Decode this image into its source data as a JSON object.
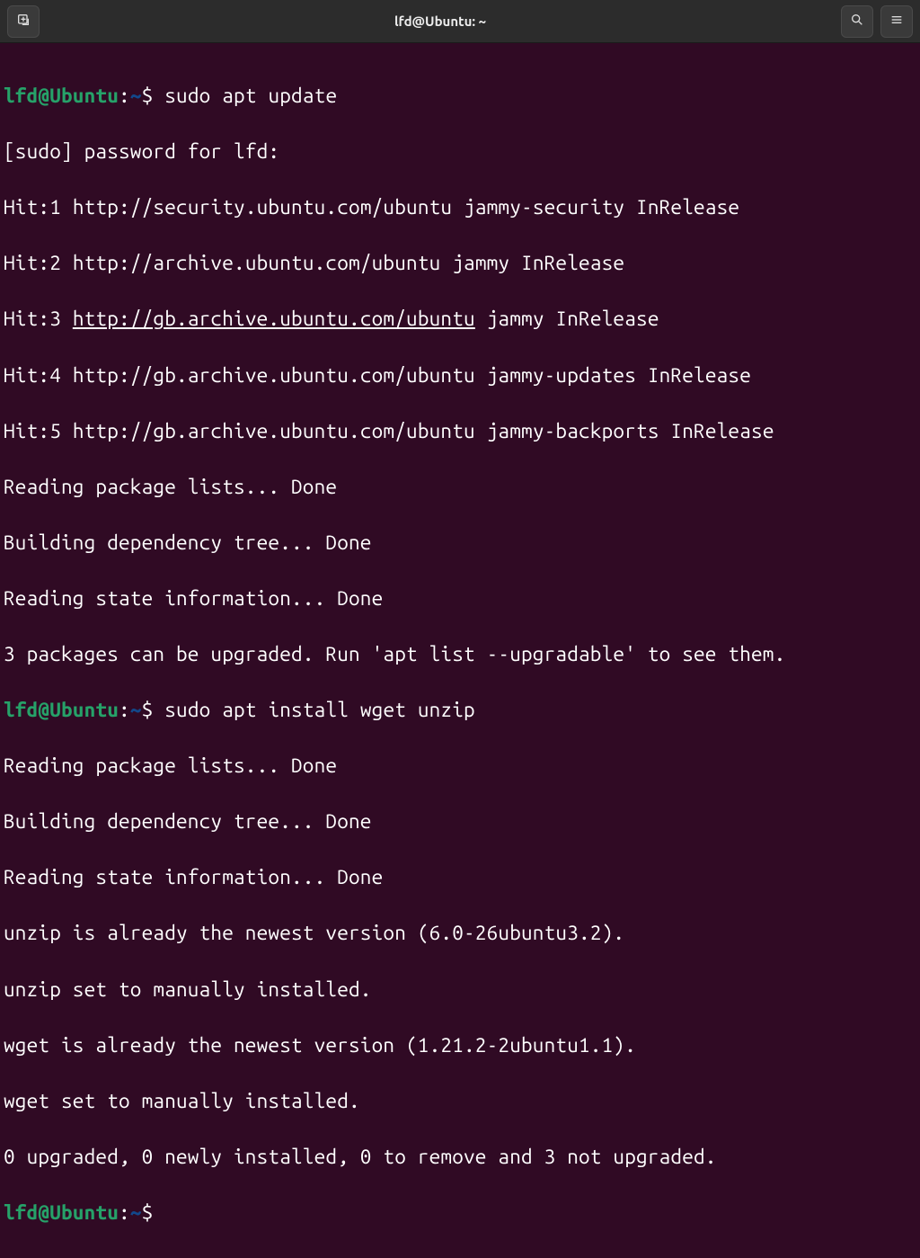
{
  "window": {
    "title": "lfd@Ubuntu: ~"
  },
  "prompt": {
    "user_host": "lfd@Ubuntu",
    "sep1": ":",
    "path": "~",
    "sep2": "$ "
  },
  "session": {
    "cmd1": "sudo apt update",
    "line_sudo_pw": "[sudo] password for lfd:",
    "hit1_a": "Hit:1 ",
    "hit1_url": "http://security.ubuntu.com/ubuntu",
    "hit1_b": " jammy-security InRelease",
    "hit2_a": "Hit:2 ",
    "hit2_url": "http://archive.ubuntu.com/ubuntu",
    "hit2_b": " jammy InRelease",
    "hit3_a": "Hit:3 ",
    "hit3_url": "http://gb.archive.ubuntu.com/ubuntu",
    "hit3_b": " jammy InRelease",
    "hit4_a": "Hit:4 ",
    "hit4_url": "http://gb.archive.ubuntu.com/ubuntu",
    "hit4_b": " jammy-updates InRelease",
    "hit5_a": "Hit:5 ",
    "hit5_url": "http://gb.archive.ubuntu.com/ubuntu",
    "hit5_b": " jammy-backports InRelease",
    "reading_pkg": "Reading package lists... Done",
    "building_dep": "Building dependency tree... Done",
    "reading_state": "Reading state information... Done",
    "upgradable_msg": "3 packages can be upgraded. Run 'apt list --upgradable' to see them.",
    "cmd2": "sudo apt install wget unzip",
    "unzip_newest": "unzip is already the newest version (6.0-26ubuntu3.2).",
    "unzip_manual": "unzip set to manually installed.",
    "wget_newest": "wget is already the newest version (1.21.2-2ubuntu1.1).",
    "wget_manual": "wget set to manually installed.",
    "summary": "0 upgraded, 0 newly installed, 0 to remove and 3 not upgraded."
  }
}
